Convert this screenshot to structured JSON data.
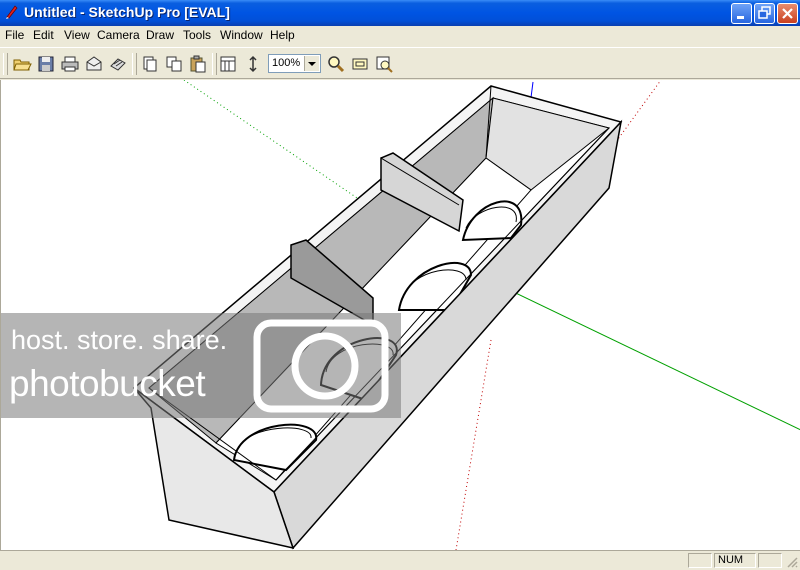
{
  "window": {
    "title": "Untitled - SketchUp Pro [EVAL]"
  },
  "menu": {
    "items": [
      {
        "label": "File"
      },
      {
        "label": "Edit"
      },
      {
        "label": "View"
      },
      {
        "label": "Camera"
      },
      {
        "label": "Draw"
      },
      {
        "label": "Tools"
      },
      {
        "label": "Window"
      },
      {
        "label": "Help"
      }
    ]
  },
  "toolbar": {
    "zoom_value": "100%",
    "icons": [
      "open-icon",
      "save-icon",
      "print-icon",
      "email-icon",
      "model-info-icon",
      "layer-icon",
      "copy-icon",
      "paste-icon",
      "section-icon",
      "dimension-icon",
      "zoom-icon",
      "zoom-window-icon",
      "zoom-extents-icon"
    ]
  },
  "watermark": {
    "line1": "host. store. share.",
    "line2": "photobucket"
  },
  "status": {
    "num": "NUM"
  },
  "colors": {
    "titlebar": "#0054e3",
    "chrome": "#ece9d8",
    "axis_green": "#00a000",
    "axis_blue": "#0000ff",
    "axis_red": "#ff0000"
  }
}
